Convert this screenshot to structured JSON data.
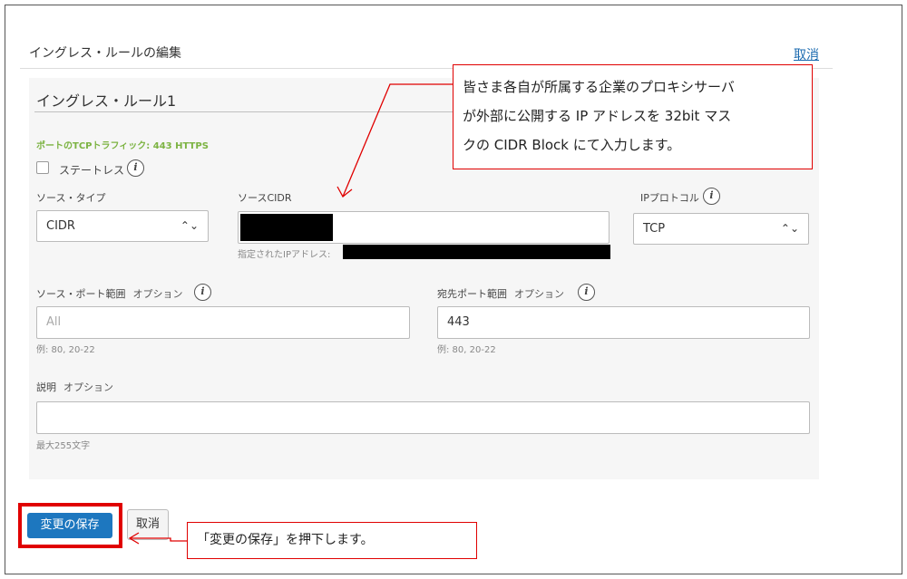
{
  "panel": {
    "title": "イングレス・ルールの編集",
    "cancel_link": "取消"
  },
  "rule": {
    "title": "イングレス・ルール1",
    "traffic_summary": "ポートのTCPトラフィック: 443 HTTPS",
    "stateless": {
      "label": "ステートレス",
      "checked": false
    }
  },
  "source_type": {
    "label": "ソース・タイプ",
    "value": "CIDR"
  },
  "source_cidr": {
    "label": "ソースCIDR",
    "hint": "指定されたIPアドレス:"
  },
  "ip_protocol": {
    "label": "IPプロトコル",
    "value": "TCP"
  },
  "source_port_range": {
    "label": "ソース・ポート範囲",
    "optional": "オプション",
    "placeholder": "All",
    "hint": "例: 80, 20-22"
  },
  "dest_port_range": {
    "label": "宛先ポート範囲",
    "optional": "オプション",
    "value": "443",
    "hint": "例: 80, 20-22"
  },
  "description": {
    "label": "説明",
    "optional": "オプション",
    "value": "",
    "hint": "最大255文字"
  },
  "buttons": {
    "save": "変更の保存",
    "cancel": "取消"
  },
  "annotations": {
    "cidr_note_lines": [
      "皆さま各自が所属する企業のプロキシサーバ",
      "が外部に公開する IP アドレスを 32bit マス",
      "クの CIDR Block にて入力します。"
    ],
    "save_note": "「変更の保存」を押下します。"
  },
  "colors": {
    "primary_button": "#1d77bf",
    "annotation_red": "#e00000",
    "summary_green": "#7cb342"
  }
}
